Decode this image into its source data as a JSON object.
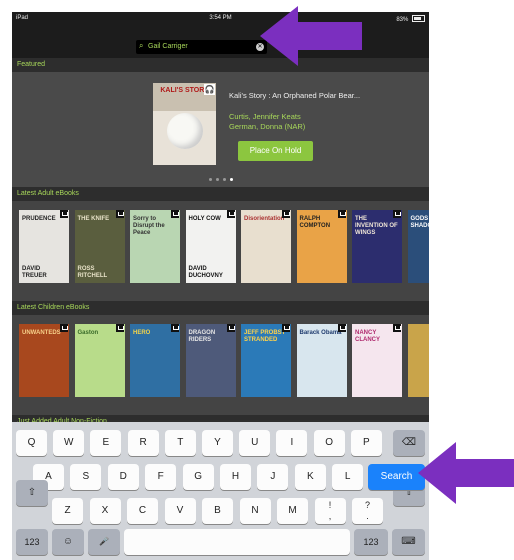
{
  "status": {
    "device": "iPad",
    "time": "3:54 PM",
    "battery": "83%"
  },
  "search": {
    "query": "Gail Carriger",
    "clear": "✕",
    "icon": "search-icon"
  },
  "featured": {
    "heading": "Featured",
    "cover_text": "KALI'S STORY",
    "title": "Kali's Story : An Orphaned Polar Bear...",
    "author_line1": "Curtis, Jennifer Keats",
    "author_line2": "German, Donna (NAR)",
    "button": "Place On Hold",
    "pager_dots": 4,
    "pager_active": 4
  },
  "adult": {
    "heading": "Latest Adult eBooks",
    "books": [
      {
        "title": "PRUDENCE",
        "author": "DAVID TREUER",
        "color": "#e6e4e0",
        "fg": "#222"
      },
      {
        "title": "THE KNIFE",
        "author": "ROSS RITCHELL",
        "color": "#5a5e3e",
        "fg": "#e8e2c8"
      },
      {
        "title": "Sorry to Disrupt the Peace",
        "author": "",
        "color": "#b9d6b2",
        "fg": "#333"
      },
      {
        "title": "HOLY COW",
        "author": "DAVID DUCHOVNY",
        "color": "#f2f2f0",
        "fg": "#111"
      },
      {
        "title": "Disorientation",
        "author": "",
        "color": "#e8dfcf",
        "fg": "#a33"
      },
      {
        "title": "RALPH COMPTON",
        "author": "",
        "color": "#e9a347",
        "fg": "#222"
      },
      {
        "title": "THE INVENTION OF WINGS",
        "author": "",
        "color": "#2c2d6e",
        "fg": "#f0e6d6"
      },
      {
        "title": "GODS SHADOW",
        "author": "",
        "color": "#2b4e7a",
        "fg": "#fff"
      }
    ]
  },
  "children": {
    "heading": "Latest Children eBooks",
    "books": [
      {
        "title": "UNWANTEDS",
        "author": "",
        "color": "#a8481e",
        "fg": "#f6d08a"
      },
      {
        "title": "Gaston",
        "author": "",
        "color": "#b8dc8a",
        "fg": "#3a6b2a"
      },
      {
        "title": "HERO",
        "author": "",
        "color": "#2f6fa3",
        "fg": "#f2d34a"
      },
      {
        "title": "DRAGON RIDERS",
        "author": "",
        "color": "#4e5a7a",
        "fg": "#e6e6e6"
      },
      {
        "title": "JEFF PROBST STRANDED",
        "author": "",
        "color": "#2b7ab8",
        "fg": "#ffd24a"
      },
      {
        "title": "Barack Obama",
        "author": "",
        "color": "#d8e6ee",
        "fg": "#1f3b6e"
      },
      {
        "title": "NANCY CLANCY",
        "author": "",
        "color": "#f5e6ee",
        "fg": "#b02a6e"
      },
      {
        "title": "",
        "author": "",
        "color": "#c9a44a",
        "fg": "#333"
      }
    ]
  },
  "nonfiction": {
    "heading": "Just Added Adult Non-Fiction"
  },
  "keyboard": {
    "row1": [
      "Q",
      "W",
      "E",
      "R",
      "T",
      "Y",
      "U",
      "I",
      "O",
      "P"
    ],
    "row2": [
      "A",
      "S",
      "D",
      "F",
      "G",
      "H",
      "J",
      "K",
      "L"
    ],
    "row3": [
      "Z",
      "X",
      "C",
      "V",
      "B",
      "N",
      "M",
      "!\n,",
      "?\n."
    ],
    "search": "Search",
    "numbers": "123",
    "shift": "⇧",
    "delete": "⌫",
    "emoji": "☺",
    "mic": "🎤",
    "hide": "⌨"
  },
  "colors": {
    "accent": "#a8d85a",
    "button": "#8cc63f",
    "search_key": "#1a82fb",
    "annotation_arrow": "#7b2fbf"
  }
}
